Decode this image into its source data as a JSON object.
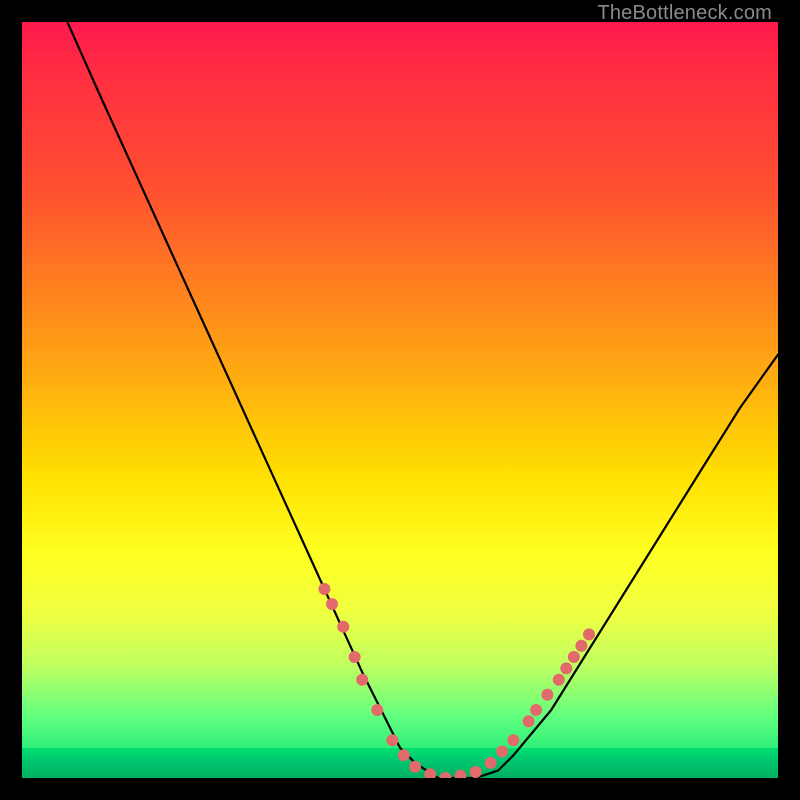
{
  "watermark": "TheBottleneck.com",
  "chart_data": {
    "type": "line",
    "title": "",
    "xlabel": "",
    "ylabel": "",
    "xlim": [
      0,
      100
    ],
    "ylim": [
      0,
      100
    ],
    "series": [
      {
        "name": "bottleneck-curve",
        "x": [
          6,
          10,
          15,
          20,
          25,
          30,
          35,
          40,
          45,
          48,
          50,
          52,
          55,
          57,
          60,
          63,
          65,
          70,
          75,
          80,
          85,
          90,
          95,
          100
        ],
        "y": [
          100,
          91,
          80,
          69,
          58,
          47,
          36,
          25,
          14,
          8,
          4,
          2,
          0,
          0,
          0,
          1,
          3,
          9,
          17,
          25,
          33,
          41,
          49,
          56
        ]
      }
    ],
    "markers": {
      "name": "highlight-dots",
      "color": "#e36a6a",
      "x": [
        40,
        41,
        42.5,
        44,
        45,
        47,
        49,
        50.5,
        52,
        54,
        56,
        58,
        60,
        62,
        63.5,
        65,
        67,
        68,
        69.5,
        71,
        72,
        73,
        74,
        75
      ],
      "y": [
        25,
        23,
        20,
        16,
        13,
        9,
        5,
        3,
        1.5,
        0.5,
        0,
        0.3,
        0.8,
        2,
        3.5,
        5,
        7.5,
        9,
        11,
        13,
        14.5,
        16,
        17.5,
        19
      ]
    }
  }
}
